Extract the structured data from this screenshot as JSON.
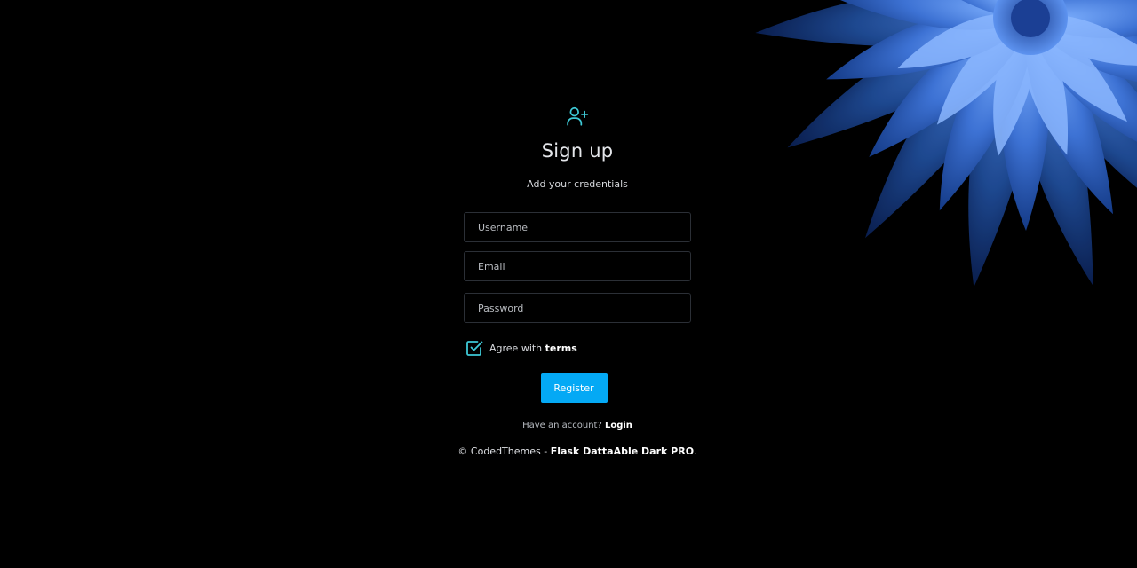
{
  "auth": {
    "icon": "user-plus-icon",
    "title": "Sign up",
    "subtitle": "Add your credentials"
  },
  "form": {
    "username_placeholder": "Username",
    "email_placeholder": "Email",
    "password_placeholder": "Password",
    "agree_prefix": "Agree with ",
    "agree_link": "terms",
    "agree_checked": true,
    "register_label": "Register"
  },
  "login_prompt": {
    "text": "Have an account? ",
    "link": "Login"
  },
  "footer": {
    "copyright": "© CodedThemes - ",
    "product": "Flask DattaAble Dark PRO",
    "suffix": "."
  },
  "colors": {
    "accent_teal": "#3ec9d6",
    "button_blue": "#04a9f5",
    "background": "#000000",
    "flower_blue": "#3a6fd0"
  },
  "decor": {
    "background_image": "blue-dahlia-flower"
  }
}
